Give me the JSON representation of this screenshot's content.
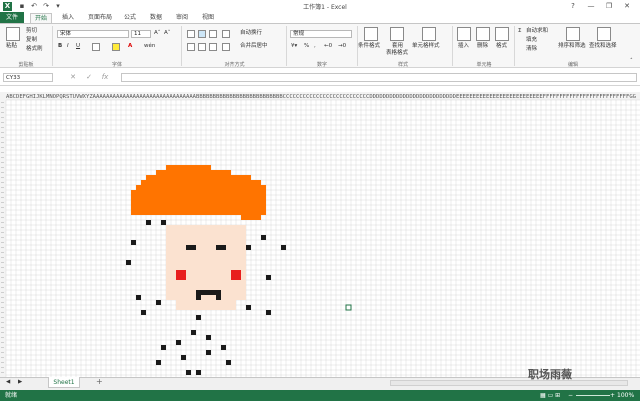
{
  "window": {
    "title": "工作簿1 - Excel",
    "help": "?",
    "minimize": "—",
    "restore": "❐",
    "close": "✕"
  },
  "quick_access": {
    "save": "💾",
    "undo": "↶",
    "redo": "↷"
  },
  "tabs": {
    "file": "文件",
    "home": "开始",
    "insert": "插入",
    "page_layout": "页面布局",
    "formulas": "公式",
    "data": "数据",
    "review": "审阅",
    "view": "视图"
  },
  "ribbon": {
    "clipboard": {
      "paste": "粘贴",
      "cut": "剪切",
      "copy": "复制",
      "format_painter": "格式刷",
      "label": "剪贴板"
    },
    "font": {
      "name": "宋体",
      "size": "11",
      "bold": "B",
      "italic": "I",
      "underline": "U",
      "label": "字体",
      "wen": "wén"
    },
    "alignment": {
      "wrap": "自动换行",
      "merge": "合并后居中",
      "label": "对齐方式"
    },
    "number": {
      "format": "常规",
      "percent": "%",
      "comma": ",",
      "label": "数字"
    },
    "styles": {
      "conditional": "条件格式",
      "table_a": "套用",
      "table_b": "表格格式",
      "cell_style": "单元格样式",
      "label": "样式"
    },
    "cells": {
      "insert": "插入",
      "delete": "删除",
      "format": "格式",
      "label": "单元格"
    },
    "editing": {
      "autosum": "自动求和",
      "fill": "填充",
      "clear": "清除",
      "sort": "排序和筛选",
      "find": "查找和选择",
      "label": "编辑"
    }
  },
  "formula_bar": {
    "name_box": "CY33",
    "cancel": "✕",
    "enter": "✓",
    "fx": "fx",
    "value": ""
  },
  "sheet": {
    "tab": "Sheet1",
    "add": "+",
    "nav_prev": "◀",
    "nav_next": "▶",
    "col_header_text": "ABCDEFGHIJKLMNOPQRSTUVWXYZAAAAAAAAAAAAAAAAAAAAAAAAAAAAAAABBBBBBBBBBBBBBBBBBBBBBBBBBCCCCCCCCCCCCCCCCCCCCCCCCCCDDDDDDDDDDDDDDDDDDDDDDDDDDEEEEEEEEEEEEEEEEEEEEEEEEEEFFFFFFFFFFFFFFFFFFFFFFFFFFGG"
  },
  "status": {
    "ready": "就绪",
    "zoom": "100%",
    "zoom_minus": "−",
    "zoom_plus": "+"
  },
  "pixel_art": {
    "hat_color": "#FF7400",
    "face_color": "#FBE2D0",
    "blush_color": "#E81E1E",
    "dark_color": "#1a1a1a",
    "cursor_color": "#217346"
  },
  "watermark": "职场雨薇"
}
